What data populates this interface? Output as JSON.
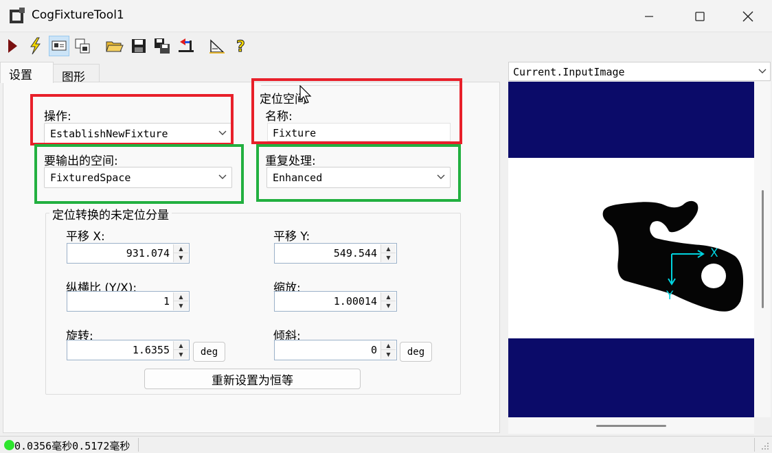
{
  "window": {
    "title": "CogFixtureTool1"
  },
  "toolbar": {
    "icons": [
      "run-icon",
      "run-lightning-icon",
      "display-toggle-icon",
      "copy-window-icon",
      "open-folder-icon",
      "save-icon",
      "save-as-icon",
      "reset-icon",
      "edit-icon",
      "help-icon"
    ]
  },
  "tabs": [
    {
      "label": "设置"
    },
    {
      "label": "图形"
    }
  ],
  "settings": {
    "operation_label": "操作:",
    "operation_value": "EstablishNewFixture",
    "output_space_label": "要输出的空间:",
    "output_space_value": "FixturedSpace",
    "fixture_space_group": "定位空间",
    "name_label": "名称:",
    "name_value": "Fixture",
    "reprocess_label": "重复处理:",
    "reprocess_value": "Enhanced"
  },
  "transform": {
    "group_title": "定位转换的未定位分量",
    "translate_x_label": "平移 X:",
    "translate_x": "931.074",
    "translate_y_label": "平移 Y:",
    "translate_y": "549.544",
    "aspect_label": "纵横比 (Y/X):",
    "aspect": "1",
    "scale_label": "缩放:",
    "scale": "1.00014",
    "rotation_label": "旋转:",
    "rotation": "1.6355",
    "skew_label": "倾斜:",
    "skew": "0",
    "deg_label": "deg",
    "reset_label": "重新设置为恒等"
  },
  "image": {
    "source": "Current.InputImage",
    "axis_x": "X",
    "axis_y": "Y"
  },
  "status": {
    "text": "0.0356毫秒0.5172毫秒"
  },
  "colors": {
    "highlight_red": "#e8202a",
    "highlight_green": "#22b040",
    "image_background": "#0b0b69",
    "axis_cyan": "#00d4e0",
    "status_ok": "#2ee52e"
  }
}
